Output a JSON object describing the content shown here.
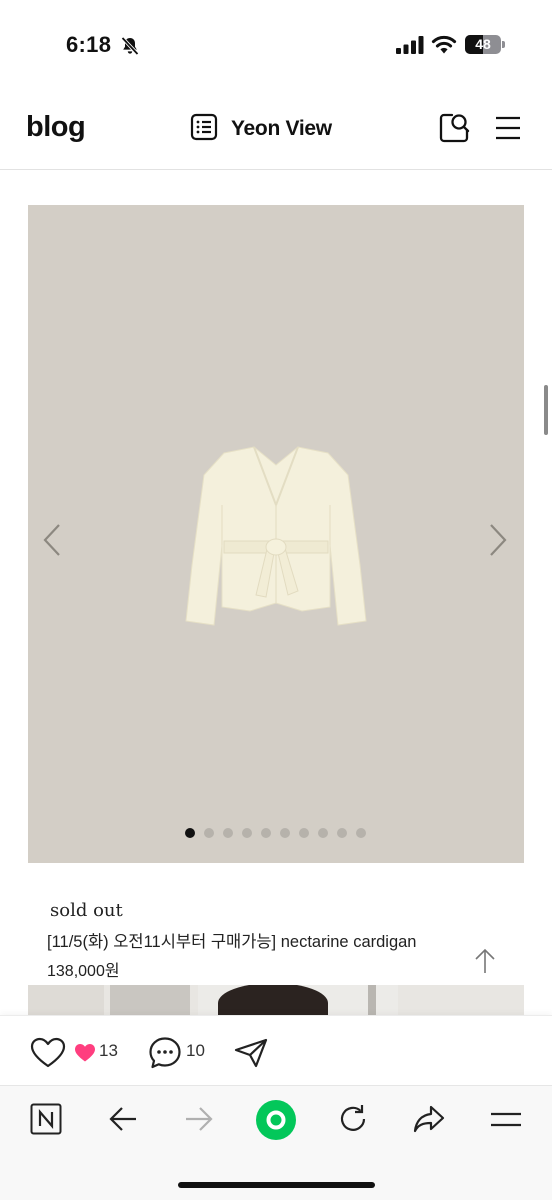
{
  "status_bar": {
    "time": "6:18",
    "battery": "48"
  },
  "header": {
    "logo": "blog",
    "blog_title": "Yeon View"
  },
  "carousel": {
    "slide_count": 10,
    "active_index": 0,
    "background_color": "#d3cec6"
  },
  "post": {
    "status_text": "sold out",
    "title": "[11/5(화) 오전11시부터 구매가능] nectarine cardigan",
    "price": "138,000원"
  },
  "reactions": {
    "like_count": "13",
    "comment_count": "10"
  },
  "colors": {
    "accent_green": "#03c75a",
    "heart_pink": "#ff3e7f"
  },
  "icons": [
    "bell-slash-icon",
    "signal-icon",
    "wifi-icon",
    "battery-icon",
    "list-icon",
    "search-icon",
    "menu-icon",
    "chevron-left-icon",
    "chevron-right-icon",
    "arrow-up-icon",
    "heart-icon",
    "comment-icon",
    "send-icon",
    "naver-n-icon",
    "back-arrow-icon",
    "forward-arrow-icon",
    "green-dot-icon",
    "reload-icon",
    "share-icon",
    "hamburger-icon"
  ]
}
